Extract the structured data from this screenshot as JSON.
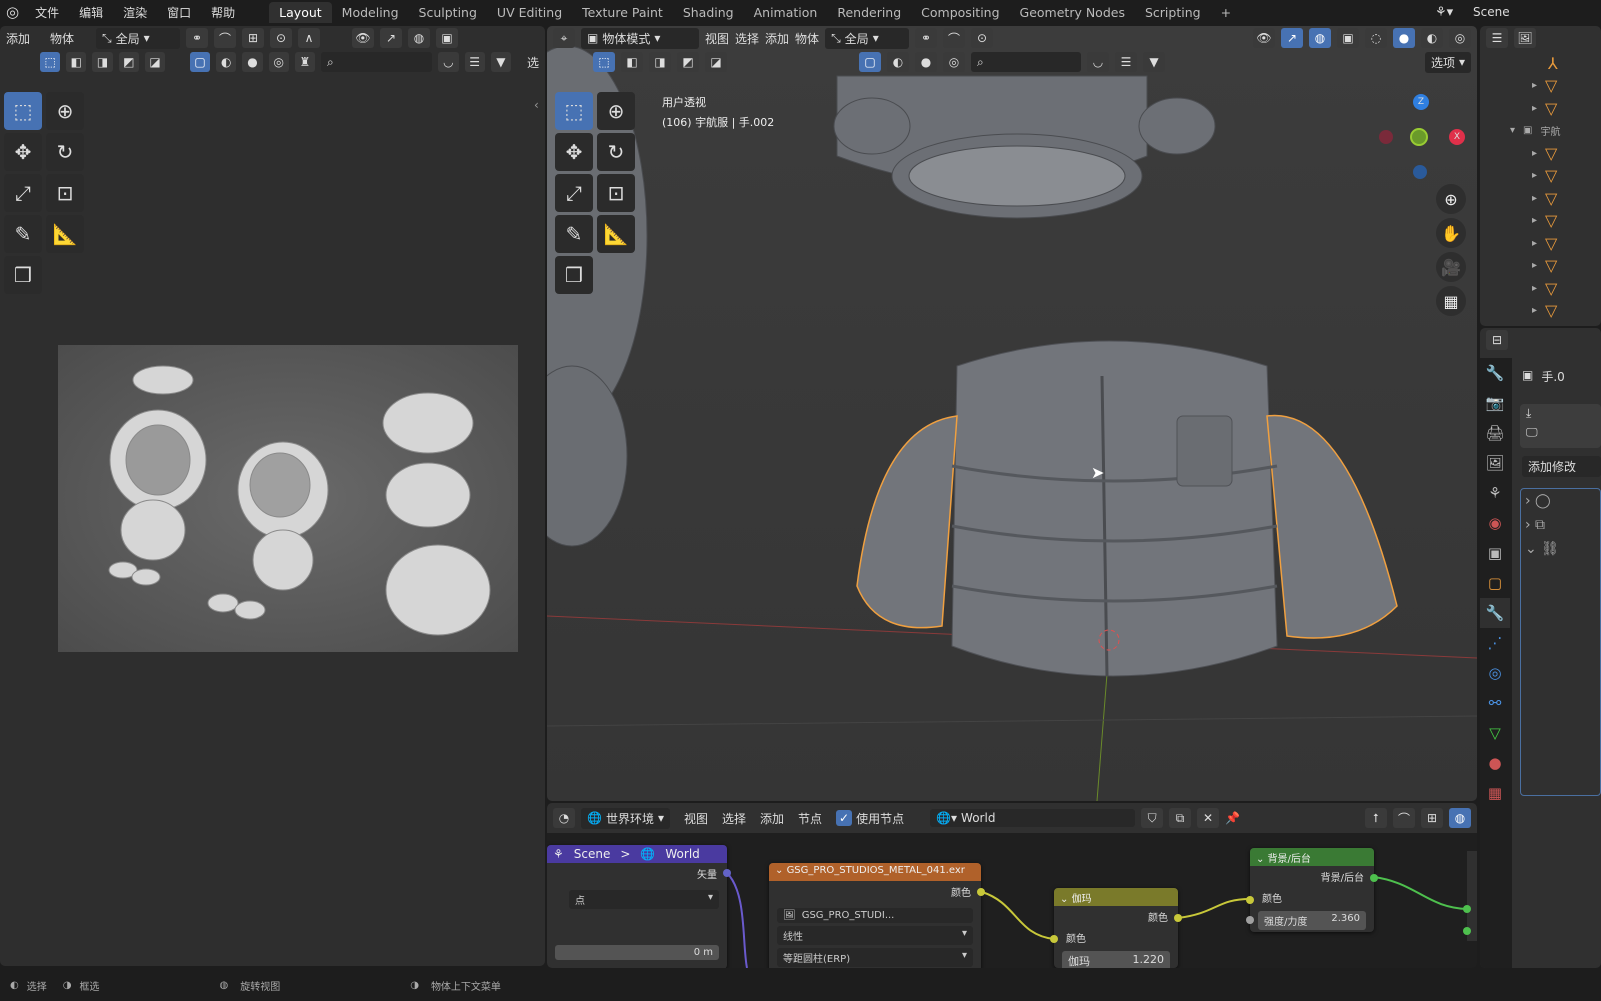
{
  "topbar": {
    "menus": [
      "文件",
      "编辑",
      "渲染",
      "窗口",
      "帮助"
    ],
    "workspaces": [
      "Layout",
      "Modeling",
      "Sculpting",
      "UV Editing",
      "Texture Paint",
      "Shading",
      "Animation",
      "Rendering",
      "Compositing",
      "Geometry Nodes",
      "Scripting"
    ],
    "active_workspace": "Layout",
    "add_tab": "+",
    "scene": "Scene"
  },
  "left_editor": {
    "menus": [
      "添加",
      "物体"
    ],
    "orientation": "全局",
    "options_partial": "选"
  },
  "viewport": {
    "mode": "物体模式",
    "menus": [
      "视图",
      "选择",
      "添加",
      "物体"
    ],
    "orientation": "全局",
    "options": "选项",
    "view_name": "用户透视",
    "object_info": "(106) 宇航服 | 手.002",
    "axes": {
      "z": "Z",
      "x": "X"
    },
    "accent": "#4772b3",
    "selection_outline": "#f0a040"
  },
  "node_editor": {
    "shader_type": "世界环境",
    "menus": [
      "视图",
      "选择",
      "添加",
      "节点"
    ],
    "use_nodes_label": "使用节点",
    "use_nodes": true,
    "world_name": "World",
    "breadcrumb": {
      "scene": "Scene",
      "world": "World",
      "sep": ">"
    },
    "mapping_node": {
      "output": "矢量",
      "dropdown": "点",
      "value": "0 m"
    },
    "env_node": {
      "title": "GSG_PRO_STUDIOS_METAL_041.exr",
      "output": "颜色",
      "image": "GSG_PRO_STUDI...",
      "interp": "线性",
      "projection": "等距圆柱(ERP)",
      "color": "#b0612a"
    },
    "gamma_node": {
      "title": "伽玛",
      "output": "颜色",
      "input": "颜色",
      "gamma_label": "伽玛",
      "gamma_value": "1.220",
      "color": "#7a7a2a"
    },
    "background_node": {
      "title": "背景/后台",
      "output": "背景/后台",
      "input": "颜色",
      "strength_label": "强度/力度",
      "strength_value": "2.360",
      "color": "#3a7a34"
    }
  },
  "outliner": {
    "collection_partial": "宇航",
    "rows": 10
  },
  "properties": {
    "object_partial": "手.0",
    "add_modifier_partial": "添加修改"
  },
  "statusbar": {
    "items": [
      "选择",
      "框选",
      "旋转视图",
      "物体上下文菜单"
    ]
  }
}
